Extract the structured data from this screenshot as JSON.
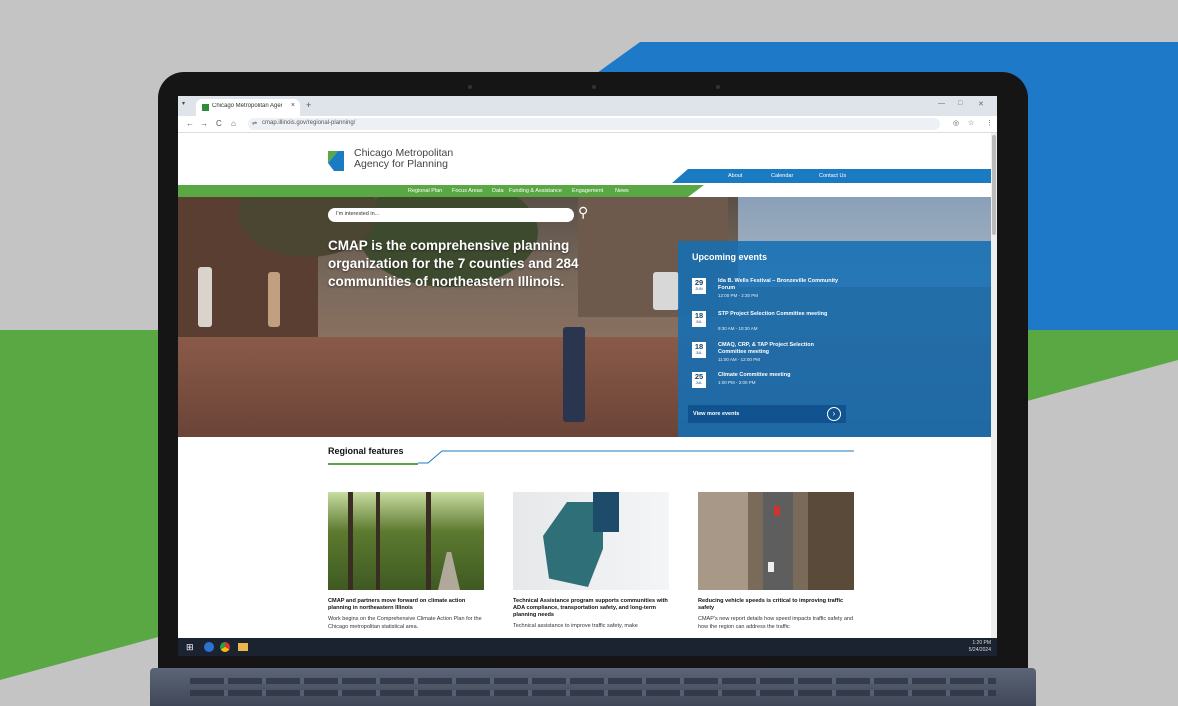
{
  "browser": {
    "tab_title": "Chicago Metropolitan Agency f...",
    "tab_close": "×",
    "new_tab": "+",
    "url": "cmap.illinois.gov/regional-planning/",
    "back": "←",
    "forward": "→",
    "reload": "C",
    "home": "⌂",
    "min": "—",
    "max": "□",
    "close": "✕"
  },
  "site": {
    "logo_line1": "Chicago Metropolitan",
    "logo_line2": "Agency for Planning",
    "utility_nav": [
      "About",
      "Calendar",
      "Contact Us"
    ],
    "main_nav": [
      "Regional Plan",
      "Focus Areas",
      "Data",
      "Funding & Assistance",
      "Engagement",
      "News"
    ]
  },
  "hero": {
    "headline": "CMAP is the comprehensive planning organization for the 7 counties and 284 communities of northeastern Illinois.",
    "search_placeholder": "I'm interested in..."
  },
  "events": {
    "title": "Upcoming events",
    "items": [
      {
        "day": "29",
        "month": "JUN",
        "name": "Ida B. Wells Festival – Bronzeville Community Forum",
        "time": "12:00 PM - 2:30 PM"
      },
      {
        "day": "18",
        "month": "JUL",
        "name": "STP Project Selection Committee meeting",
        "time": "9:30 AM - 10:30 AM"
      },
      {
        "day": "18",
        "month": "JUL",
        "name": "CMAQ, CRP, & TAP Project Selection Committee meeting",
        "time": "11:00 AM - 12:00 PM"
      },
      {
        "day": "25",
        "month": "JUL",
        "name": "Climate Committee meeting",
        "time": "1:00 PM - 2:00 PM"
      }
    ],
    "more_label": "View more events"
  },
  "features": {
    "heading": "Regional features",
    "cards": [
      {
        "title": "CMAP and partners move forward on climate action planning in northeastern Illinois",
        "body": "Work begins on the Comprehensive Climate Action Plan for the Chicago metropolitan statistical area."
      },
      {
        "title": "Technical Assistance program supports communities with ADA compliance, transportation safety, and long-term planning needs",
        "body": "Technical assistance to improve traffic safety, make"
      },
      {
        "title": "Reducing vehicle speeds is critical to improving traffic safety",
        "body": "CMAP's new report details how speed impacts traffic safety and how the region can address the traffic"
      }
    ]
  },
  "taskbar": {
    "time": "1:20 PM",
    "date": "5/24/2024"
  },
  "colors": {
    "cmap_blue": "#1b7bc2",
    "cmap_green": "#5aa843",
    "background_gray": "#c4c4c4"
  }
}
